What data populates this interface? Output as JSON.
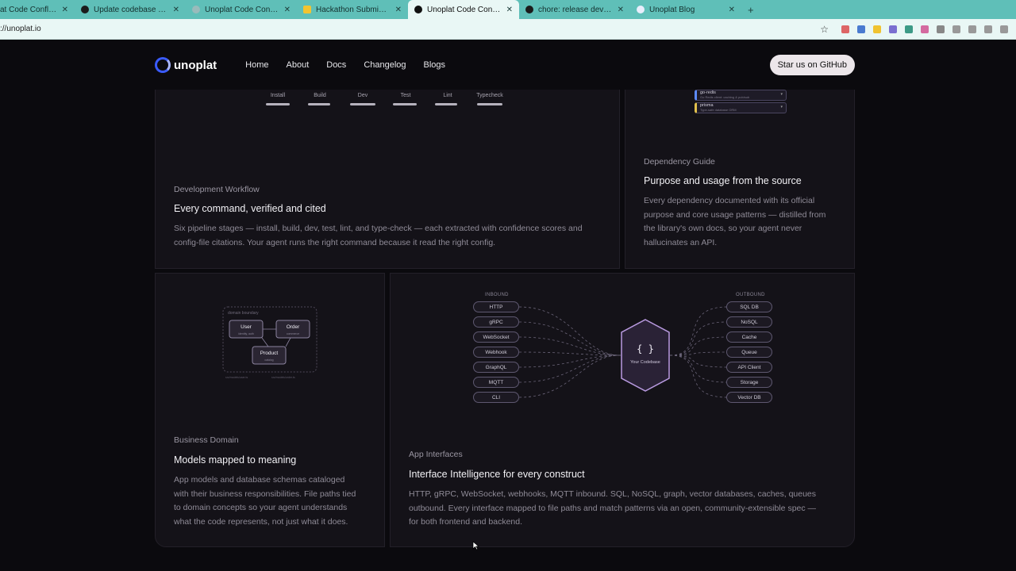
{
  "browser": {
    "tabs": [
      {
        "title": "at Code Confluen",
        "active": false
      },
      {
        "title": "Update codebase artifa",
        "active": false
      },
      {
        "title": "Unoplat Code Confluen",
        "active": false
      },
      {
        "title": "Hackathon Submission",
        "active": false
      },
      {
        "title": "Unoplat Code Confluen",
        "active": true
      },
      {
        "title": "chore: release dev by J",
        "active": false
      },
      {
        "title": "Unoplat Blog",
        "active": false
      }
    ],
    "new_tab": "+",
    "url": "://unoplat.io"
  },
  "nav": {
    "logo_text": "unoplat",
    "links": [
      "Home",
      "About",
      "Docs",
      "Changelog",
      "Blogs"
    ],
    "cta": "Star us on GitHub"
  },
  "workflow_card": {
    "stages": [
      "Install",
      "Build",
      "Dev",
      "Test",
      "Lint",
      "Typecheck"
    ],
    "category": "Development Workflow",
    "heading": "Every command, verified and cited",
    "body_line1": "Six pipeline stages — install, build, dev, test, lint, and type-check — each extracted with confidence scores and",
    "body_line2": "config-file citations. Your agent runs the right command because it read the right config."
  },
  "dependency_card": {
    "mini_items": [
      {
        "name": "go-redis",
        "desc": "Go Redis client: caching & pub/sub"
      },
      {
        "name": "prisma",
        "desc": "Type-safe database ORM"
      }
    ],
    "category": "Dependency Guide",
    "heading": "Purpose and usage from the source",
    "body_lines": [
      "Every dependency documented with its official",
      "purpose and core usage patterns — distilled from",
      "the library's own docs, so your agent never",
      "hallucinates an API."
    ]
  },
  "domain_card": {
    "diagram": {
      "boundary_label": "domain boundary",
      "nodes": [
        {
          "name": "User",
          "sub": "identity, auth"
        },
        {
          "name": "Order",
          "sub": "commerce"
        },
        {
          "name": "Product",
          "sub": "catalog"
        }
      ],
      "footer_left": "src/models/user.ts",
      "footer_right": "src/models/order.ts"
    },
    "category": "Business Domain",
    "heading": "Models mapped to meaning",
    "body_lines": [
      "App models and database schemas cataloged",
      "with their business responsibilities. File paths tied",
      "to domain concepts so your agent understands",
      "what the code represents, not just what it does."
    ]
  },
  "interfaces_card": {
    "inbound_label": "INBOUND",
    "outbound_label": "OUTBOUND",
    "inbound": [
      "HTTP",
      "gRPC",
      "WebSocket",
      "Webhook",
      "GraphQL",
      "MQTT",
      "CLI"
    ],
    "outbound": [
      "SQL DB",
      "NoSQL",
      "Cache",
      "Queue",
      "API Client",
      "Storage",
      "Vector DB"
    ],
    "center_glyph": "{ }",
    "center_label": "Your Codebase",
    "category": "App Interfaces",
    "heading": "Interface Intelligence for every construct",
    "body_lines": [
      "HTTP, gRPC, WebSocket, webhooks, MQTT inbound. SQL, NoSQL, graph, vector databases, caches, queues",
      "outbound. Every interface mapped to file paths and match patterns via an open, community-extensible spec —",
      "for both frontend and backend."
    ]
  },
  "colors": {
    "tab_bar": "#5fbfb8",
    "page_bg": "#0b0a0e",
    "card_bg": "#141218",
    "accent_purple": "#b99ae0"
  }
}
